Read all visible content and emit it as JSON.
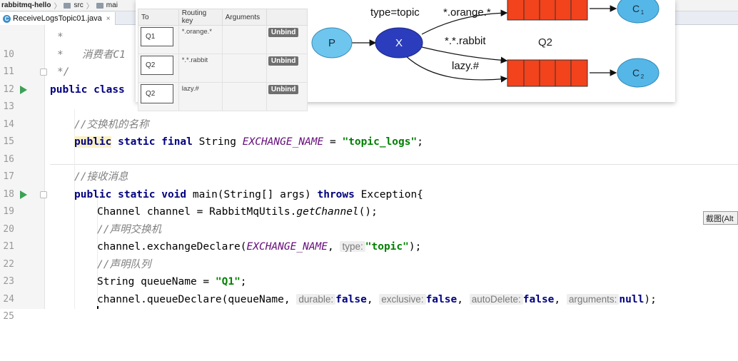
{
  "breadcrumb": {
    "project": "rabbitmq-hello",
    "folder1": "src",
    "folder2": "mai"
  },
  "tab": {
    "filename": "ReceiveLogsTopic01.java",
    "icon": "java-class-icon",
    "close": "×"
  },
  "overlay": {
    "bindings_table": {
      "headers": [
        "To",
        "Routing key",
        "Arguments"
      ],
      "rows": [
        {
          "to": "Q1",
          "routing_key": "*.orange.*",
          "arguments": "",
          "action": "Unbind"
        },
        {
          "to": "Q2",
          "routing_key": "*.*.rabbit",
          "arguments": "",
          "action": "Unbind"
        },
        {
          "to": "Q2",
          "routing_key": "lazy.#",
          "arguments": "",
          "action": "Unbind"
        }
      ]
    },
    "diagram": {
      "producer": "P",
      "exchange": "X",
      "type_label": "type=topic",
      "key1": "*.orange.*",
      "key2": "*.*.rabbit",
      "key3": "lazy.#",
      "queue2_label": "Q2",
      "consumer1": "C",
      "consumer1_sub": "1",
      "consumer2": "C",
      "consumer2_sub": "2"
    }
  },
  "code": {
    "lines": [
      {
        "n": "10",
        "text": "*"
      },
      {
        "n": "11",
        "text": "*   消费者C1"
      },
      {
        "n": "12",
        "text": "*/"
      },
      {
        "n": "13",
        "pub": "public",
        "cls": "class"
      },
      {
        "n": "14"
      },
      {
        "n": "15",
        "text": "//交换机的名称"
      },
      {
        "n": "16",
        "mod1": "public",
        "mod2": "static final",
        "type": "String",
        "field": "EXCHANGE_NAME",
        "eq": "=",
        "str": "\"topic_logs\"",
        "semi": ";"
      },
      {
        "n": "17"
      },
      {
        "n": "18",
        "text": "//接收消息"
      },
      {
        "n": "19",
        "mods": "public static void",
        "sig": "main(String[] args)",
        "throws": "throws",
        "exc": "Exception{"
      },
      {
        "n": "20",
        "pre": "Channel channel = RabbitMqUtils.",
        "method": "getChannel",
        "post": "();"
      },
      {
        "n": "21",
        "text": "//声明交换机"
      },
      {
        "n": "22",
        "pre": "channel.exchangeDeclare(",
        "field": "EXCHANGE_NAME",
        "comma": ",",
        "hint": "type:",
        "str": "\"topic\"",
        "post": ");"
      },
      {
        "n": "23",
        "text": "//声明队列"
      },
      {
        "n": "24",
        "pre": "String queueName =",
        "str": "\"Q1\"",
        "post": ";"
      },
      {
        "n": "25",
        "pre": "channel.queueDeclare(queueName,",
        "h1": "durable:",
        "v1": "false",
        "c1": ",",
        "h2": "exclusive:",
        "v2": "false",
        "c2": ",",
        "h3": "autoDelete:",
        "v3": "false",
        "c3": ",",
        "h4": "arguments:",
        "v4": "null",
        "post": ");"
      }
    ]
  },
  "screenshot_tool": {
    "label": "截图(Alt"
  },
  "colors": {
    "keyword": "#000080",
    "string": "#008000",
    "field": "#660e7a",
    "comment": "#808080",
    "queue": "#f2431d",
    "exchange": "#2b3dbd",
    "producer": "#6ec6ef",
    "consumer": "#55b7e8"
  }
}
